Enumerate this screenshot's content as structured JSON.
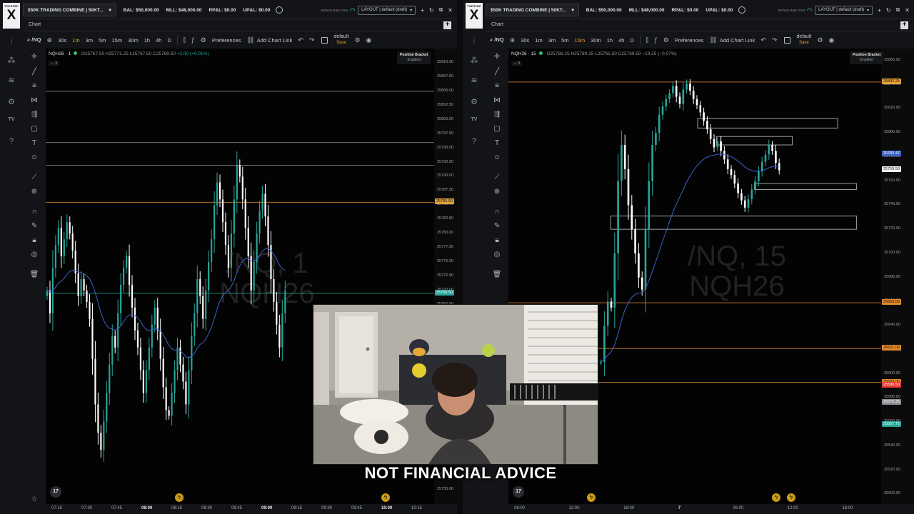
{
  "app": {
    "logo_text": "TOPSTEP",
    "logo_letter": "X",
    "caption": "NOT FINANCIAL ADVICE",
    "colors": {
      "bull": "#26a69a",
      "bear": "#ffffff",
      "accent": "#e3a23a",
      "level_orange": "#e08a2c",
      "ma_line": "#3d63c9"
    }
  },
  "panels": [
    {
      "topbar": {
        "account": "$50K TRADING COMBINE | 50KT...",
        "bal": "BAL: $50,000.00",
        "mll": "MLL: $48,000.00",
        "rpl": "RP&L: $0.00",
        "upl": "UP&L: $0.00",
        "refresh": "Refresh Rate: Fast",
        "layout_select": "LAYOUT | default (draft)"
      },
      "tab_label": "Chart",
      "toolbar": {
        "symbol": "/NQ",
        "intervals": [
          "30s",
          "1m",
          "3m",
          "5m",
          "15m",
          "30m",
          "1h",
          "4h",
          "D"
        ],
        "active_interval": "1m",
        "preferences": "Preferences",
        "add_chart_link": "Add Chart Link",
        "layout_name": "default",
        "layout_save": "Save"
      },
      "legend": {
        "title": "NQH26 · 1",
        "o": "O25767.50",
        "h": "H25771.25",
        "l": "L25767.50",
        "c": "C25769.50",
        "chg": "+2.00 (+0.01%)",
        "collapse": "⌄ 3"
      },
      "position_bracket": {
        "label": "Position Bracket",
        "state": "Enabled"
      },
      "watermark": [
        "/NQ, 1",
        "NQH26"
      ],
      "price_scale": {
        "min": 25732.5,
        "max": 25812.5,
        "labels": [
          "25810.00",
          "25807.50",
          "25805.00",
          "25802.50",
          "25800.00",
          "25797.50",
          "25795.00",
          "25792.50",
          "25790.00",
          "25787.50",
          "25785.00",
          "25782.50",
          "25780.00",
          "25777.50",
          "25775.00",
          "25772.50",
          "25770.00",
          "25767.50",
          "25765.00",
          "25762.50",
          "25760.00",
          "25757.50",
          "25755.00",
          "25752.50",
          "25750.00",
          "25747.50",
          "25745.00",
          "25742.50",
          "25740.00",
          "25737.50",
          "25735.00"
        ],
        "badges": [
          {
            "text": "25785.50",
            "value": 25785.5,
            "color": "#e3a23a"
          },
          {
            "text": "25769.50",
            "value": 25769.5,
            "color": "#26a69a"
          }
        ]
      },
      "time_scale": [
        "07:15",
        "07:30",
        "07:45",
        "08:00",
        "08:15",
        "08:30",
        "08:45",
        "09:00",
        "09:15",
        "09:30",
        "09:45",
        "10:00",
        "10:15"
      ],
      "bold_times": [
        "08:00",
        "09:00",
        "10:00"
      ],
      "levels": [
        {
          "value": 25805.0,
          "color": "#8a8d92"
        },
        {
          "value": 25796.0,
          "color": "#8a8d92"
        },
        {
          "value": 25792.0,
          "color": "#8a8d92"
        },
        {
          "value": 25785.5,
          "color": "#e08a2c"
        },
        {
          "value": 25769.5,
          "color": "#26a69a"
        }
      ],
      "chart_data": {
        "type": "candlestick",
        "y_range": [
          25732.5,
          25812.5
        ],
        "closes": [
          25770,
          25766,
          25774,
          25778,
          25781,
          25776,
          25779,
          25782,
          25780,
          25777,
          25773,
          25769,
          25772,
          25770,
          25768,
          25765,
          25758,
          25750,
          25745,
          25742,
          25747,
          25752,
          25757,
          25762,
          25760,
          25766,
          25771,
          25774,
          25776,
          25771,
          25767,
          25763,
          25760,
          25756,
          25752,
          25756,
          25760,
          25764,
          25767,
          25763,
          25758,
          25753,
          25749,
          25748,
          25752,
          25756,
          25760,
          25757,
          25754,
          25750,
          25756,
          25762,
          25766,
          25772,
          25769,
          25765,
          25770,
          25775,
          25779,
          25785,
          25789,
          25786,
          25782,
          25778,
          25774,
          25780,
          25786,
          25792,
          25790,
          25786,
          25781,
          25776,
          25770,
          25775,
          25780,
          25784,
          25787,
          25783,
          25778,
          25772,
          25768,
          25764,
          25760,
          25766,
          25770
        ]
      }
    },
    {
      "topbar": {
        "account": "$50K TRADING COMBINE | 50KT...",
        "bal": "BAL: $50,000.00",
        "mll": "MLL: $48,000.00",
        "rpl": "RP&L: $0.00",
        "upl": "UP&L: $0.00",
        "refresh": "Refresh Rate: Fast",
        "layout_select": "LAYOUT | default (draft)"
      },
      "tab_label": "Chart",
      "toolbar": {
        "symbol": "/NQ",
        "intervals": [
          "30s",
          "1m",
          "3m",
          "5m",
          "15m",
          "30m",
          "1h",
          "4h",
          "D"
        ],
        "active_interval": "15m",
        "preferences": "Preferences",
        "add_chart_link": "Add Chart Link",
        "layout_name": "default",
        "layout_save": "Save"
      },
      "legend": {
        "title": "NQH26 · 15",
        "o": "O25788.25",
        "h": "H25789.25",
        "l": "L25761.50",
        "c": "C25769.50",
        "chg": "−19.25 (−0.07%)",
        "collapse": "⌄ 3"
      },
      "position_bracket": {
        "label": "Position Bracket",
        "state": "Enabled"
      },
      "watermark": [
        "/NQ, 15",
        "NQH26"
      ],
      "price_scale": {
        "min": 25492,
        "max": 25870,
        "labels": [
          "25860.00",
          "25840.00",
          "25820.00",
          "25800.00",
          "25780.00",
          "25760.00",
          "25740.00",
          "25720.00",
          "25700.00",
          "25680.00",
          "25660.00",
          "25640.00",
          "25620.00",
          "25600.00",
          "25580.00",
          "25560.00",
          "25540.00",
          "25520.00",
          "25500.00"
        ],
        "badges": [
          {
            "text": "25842.25",
            "value": 25842.25,
            "color": "#e3a23a"
          },
          {
            "text": "25782.47",
            "value": 25782.47,
            "color": "#3d63c9"
          },
          {
            "text": "25769.50",
            "value": 25769.5,
            "color": "#ffffff"
          },
          {
            "text": "25659.00",
            "value": 25659.0,
            "color": "#e08a2c"
          },
          {
            "text": "25621.00",
            "value": 25621.0,
            "color": "#e08a2c"
          },
          {
            "text": "25593.00",
            "value": 25593.0,
            "color": "#e08a2c"
          },
          {
            "text": "25590.50",
            "value": 25590.5,
            "color": "#e53935"
          },
          {
            "text": "25576.25",
            "value": 25576.25,
            "color": "#8a8d92"
          },
          {
            "text": "25557.75",
            "value": 25557.75,
            "color": "#26a69a"
          }
        ]
      },
      "time_scale": [
        "06:00",
        "12:00",
        "18:00",
        "7",
        "06:00",
        "12:00",
        "18:00"
      ],
      "bold_times": [
        "7"
      ],
      "levels": [
        {
          "value": 25842.25,
          "color": "#e08a2c"
        },
        {
          "value": 25659.0,
          "color": "#e08a2c"
        },
        {
          "value": 25621.0,
          "color": "#e08a2c"
        },
        {
          "value": 25593.0,
          "color": "#e08a2c"
        }
      ],
      "zones": [
        {
          "y1": 25812,
          "y2": 25804,
          "x1": 0.5,
          "x2": 0.87
        },
        {
          "y1": 25797,
          "y2": 25790,
          "x1": 0.55,
          "x2": 0.75
        },
        {
          "y1": 25758,
          "y2": 25753,
          "x1": 0.65,
          "x2": 0.92
        },
        {
          "y1": 25731,
          "y2": 25720,
          "x1": 0.27,
          "x2": 0.92
        }
      ],
      "chart_data": {
        "type": "candlestick",
        "y_range": [
          25492,
          25870
        ],
        "closes": [
          25610,
          25640,
          25660,
          25655,
          25700,
          25760,
          25790,
          25770,
          25740,
          25720,
          25700,
          25680,
          25670,
          25720,
          25760,
          25790,
          25800,
          25815,
          25822,
          25828,
          25833,
          25839,
          25830,
          25824,
          25836,
          25841,
          25835,
          25828,
          25823,
          25817,
          25810,
          25803,
          25795,
          25788,
          25793,
          25785,
          25778,
          25770,
          25765,
          25758,
          25750,
          25744,
          25738,
          25745,
          25753,
          25760,
          25768,
          25776,
          25782,
          25790,
          25785,
          25775,
          25769
        ]
      }
    }
  ],
  "webcam": {
    "description_free": true
  }
}
